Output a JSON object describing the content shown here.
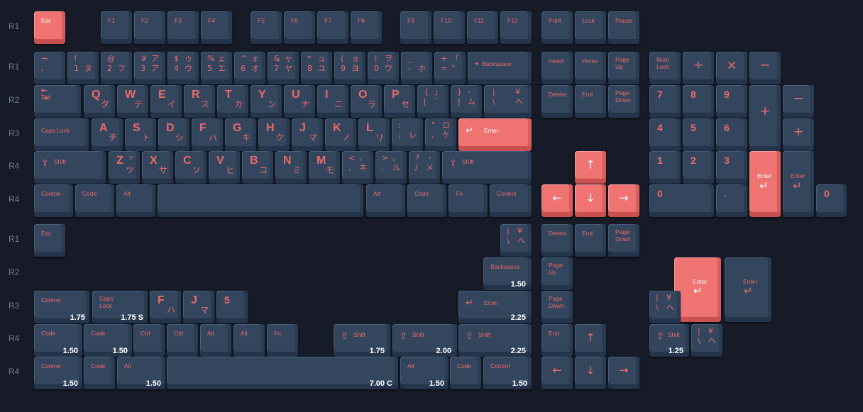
{
  "row_labels": [
    "R1",
    "R1",
    "R2",
    "R3",
    "R4",
    "R4",
    "R1",
    "R2",
    "R3",
    "R4",
    "R4"
  ],
  "colors": {
    "background": "#161b27",
    "key": "#33465e",
    "accent_key": "#ee7371",
    "legend": "#ef6a68",
    "width_label": "#ffffff"
  },
  "keys": {
    "esc": "Esc",
    "f1": "F1",
    "f2": "F2",
    "f3": "F3",
    "f4": "F4",
    "f5": "F5",
    "f6": "F6",
    "f7": "F7",
    "f8": "F8",
    "f9": "F9",
    "f10": "F10",
    "f11": "F11",
    "f12": "F12",
    "print": "Print",
    "lock": "Lock",
    "pause": "Pause",
    "grave_top": "~",
    "grave_bot": "、",
    "n1_top": "!",
    "n1_bot": "1",
    "n1_kana": "ヌ",
    "n2_top": "@",
    "n2_bot": "2",
    "n2_kana": "フ",
    "n3_top": "#",
    "n3_kt": "ア",
    "n3_bot": "3",
    "n3_kana": "ア",
    "n4_top": "$",
    "n4_kt": "ゥ",
    "n4_bot": "4",
    "n4_kana": "ウ",
    "n5_top": "%",
    "n5_kt": "ェ",
    "n5_bot": "5",
    "n5_kana": "エ",
    "n6_top": "^",
    "n6_kt": "ォ",
    "n6_bot": "6",
    "n6_kana": "オ",
    "n7_top": "&",
    "n7_kt": "ャ",
    "n7_bot": "7",
    "n7_kana": "ヤ",
    "n8_top": "*",
    "n8_kt": "ュ",
    "n8_bot": "8",
    "n8_kana": "ユ",
    "n9_top": "(",
    "n9_kt": "ョ",
    "n9_bot": "9",
    "n9_kana": "ヨ",
    "n0_top": ")",
    "n0_kt": "ヲ",
    "n0_bot": "0",
    "n0_kana": "ワ",
    "minus_top": "_",
    "minus_bot": "-",
    "minus_kana": "ホ",
    "equal_top": "+",
    "equal_kt": "「",
    "equal_bot": "=",
    "equal_kana": "°",
    "backspace": "Backspace",
    "insert": "Insert",
    "home": "Home",
    "page_up": "Page\nUp",
    "num_lock": "Num\nLock",
    "np_div": "÷",
    "np_mul": "×",
    "np_minus": "−",
    "tab": "Tab",
    "q": "Q",
    "q_k": "タ",
    "w": "W",
    "w_k": "テ",
    "e": "E",
    "e_k": "イ",
    "r": "R",
    "r_k": "ス",
    "t": "T",
    "t_k": "カ",
    "y": "Y",
    "y_k": "ン",
    "u": "U",
    "u_k": "ナ",
    "i": "I",
    "i_k": "ニ",
    "o": "O",
    "o_k": "ラ",
    "p": "P",
    "p_k": "セ",
    "lbr_top": "{",
    "lbr_kt": "」",
    "lbr_bot": "[",
    "lbr_kana": "゛",
    "rbr_top": "}",
    "rbr_kt": "-",
    "rbr_bot": "]",
    "rbr_kana": "ム",
    "bsl_top": "|",
    "bsl_kt": "¥",
    "bsl_bot": "\\",
    "bsl_kana": "へ",
    "delete": "Delete",
    "end": "End",
    "page_down": "Page\nDown",
    "np7": "7",
    "np8": "8",
    "np9": "9",
    "np_plus": "+",
    "np_minus2": "−",
    "np_plus2": "+",
    "caps_lock": "Caps Lock",
    "a": "A",
    "a_k": "チ",
    "s": "S",
    "s_k": "ト",
    "d": "D",
    "d_k": "シ",
    "f": "F",
    "f_k": "ハ",
    "g": "G",
    "g_k": "キ",
    "h": "H",
    "h_k": "ク",
    "j": "J",
    "j_k": "マ",
    "k": "K",
    "k_k": "ノ",
    "l": "L",
    "l_k": "リ",
    "semi_top": ":",
    "semi_bot": ";",
    "semi_kana": "レ",
    "quote_top": "\"",
    "quote_kt": "ロ",
    "quote_bot": ",",
    "quote_kana": "ケ",
    "enter": "Enter",
    "np4": "4",
    "np5": "5",
    "np6": "6",
    "shift": "Shift",
    "z": "Z",
    "z_kt": "ッ",
    "z_k": "ツ",
    "x": "X",
    "x_k": "サ",
    "c": "C",
    "c_k": "ソ",
    "v": "V",
    "v_k": "ヒ",
    "b": "B",
    "b_k": "コ",
    "n": "N",
    "n_k": "ミ",
    "m": "M",
    "m_k": "モ",
    "comma_top": "<",
    "comma_kt": "、",
    "comma_bot": ",",
    "comma_kana": "ネ",
    "period_top": ">",
    "period_kt": "。",
    "period_bot": ".",
    "period_kana": "ル",
    "slash_top": "?",
    "slash_kt": "・",
    "slash_bot": "/",
    "slash_kana": "メ",
    "np1": "1",
    "np2": "2",
    "np3": "3",
    "control": "Control",
    "code": "Code",
    "alt": "Alt",
    "fn": "Fn",
    "ctrl": "Ctrl",
    "np0": "0",
    "np_dot": ".",
    "np0_alt": "0",
    "five": "5",
    "w_1_75": "1.75",
    "w_1_75_s": "1.75 S",
    "w_2_25": "2.25",
    "w_1_50": "1.50",
    "w_2_00": "2.00",
    "w_1_25": "1.25",
    "w_7_00_c": "7.00 C"
  },
  "icons": {
    "up_arrow": "↑",
    "down_arrow": "↓",
    "left_arrow": "←",
    "right_arrow": "→",
    "tab_icon": "⇤ ⇥",
    "enter_icon": "↵",
    "shift_icon": "⇧",
    "backspace_icon": "◂"
  }
}
